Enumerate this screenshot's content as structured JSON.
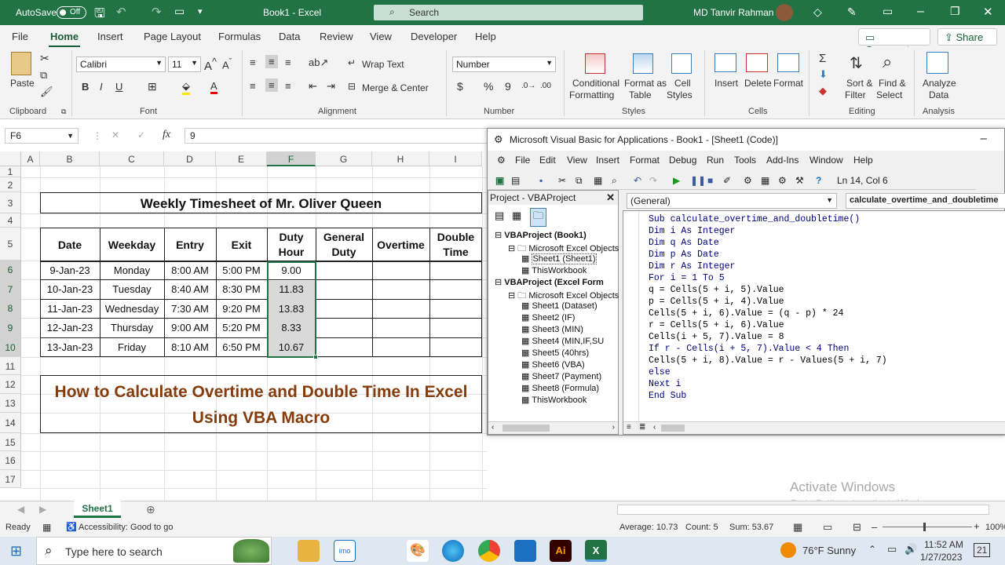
{
  "title_bar": {
    "autosave": "AutoSave",
    "toggle": "Off",
    "doc_title": "Book1  -  Excel",
    "search": "Search",
    "user": "MD Tanvir Rahman"
  },
  "tabs": [
    "File",
    "Home",
    "Insert",
    "Page Layout",
    "Formulas",
    "Data",
    "Review",
    "View",
    "Developer",
    "Help"
  ],
  "comments": "Comments",
  "share": "Share",
  "ribbon": {
    "paste": "Paste",
    "clipboard": "Clipboard",
    "font_name": "Calibri",
    "font_size": "11",
    "font": "Font",
    "wrap_text": "Wrap Text",
    "merge_center": "Merge & Center",
    "alignment": "Alignment",
    "number_format": "Number",
    "number": "Number",
    "conditional": "Conditional",
    "formatting": "Formatting",
    "format_as": "Format as",
    "table": "Table",
    "cell": "Cell",
    "styles_word": "Styles",
    "styles": "Styles",
    "insert": "Insert",
    "delete": "Delete",
    "format": "Format",
    "cells": "Cells",
    "sort_filter": "Sort &",
    "filter": "Filter",
    "find_select": "Find &",
    "select": "Select",
    "editing": "Editing",
    "analyze": "Analyze",
    "data": "Data",
    "analysis": "Analysis"
  },
  "formula_bar": {
    "name_box": "F6",
    "formula": "9"
  },
  "columns": [
    "A",
    "B",
    "C",
    "D",
    "E",
    "F",
    "G",
    "H",
    "I"
  ],
  "rows": [
    "1",
    "2",
    "3",
    "4",
    "5",
    "6",
    "7",
    "8",
    "9",
    "10",
    "11",
    "12",
    "13",
    "14",
    "15",
    "16",
    "17"
  ],
  "sheet": {
    "title": "Weekly Timesheet of Mr. Oliver Queen",
    "headers": [
      "Date",
      "Weekday",
      "Entry",
      "Exit",
      "Duty Hour",
      "General Duty",
      "Overtime",
      "Double Time"
    ],
    "data": [
      [
        "9-Jan-23",
        "Monday",
        "8:00 AM",
        "5:00 PM",
        "9.00"
      ],
      [
        "10-Jan-23",
        "Tuesday",
        "8:40 AM",
        "8:30 PM",
        "11.83"
      ],
      [
        "11-Jan-23",
        "Wednesday",
        "7:30 AM",
        "9:20 PM",
        "13.83"
      ],
      [
        "12-Jan-23",
        "Thursday",
        "9:00 AM",
        "5:20 PM",
        "8.33"
      ],
      [
        "13-Jan-23",
        "Friday",
        "8:10 AM",
        "6:50 PM",
        "10.67"
      ]
    ],
    "banner_1": "How to Calculate Overtime and Double Time In Excel",
    "banner_2": "Using VBA Macro"
  },
  "vba": {
    "title": "Microsoft Visual Basic for Applications - Book1 - [Sheet1 (Code)]",
    "menu": [
      "File",
      "Edit",
      "View",
      "Insert",
      "Format",
      "Debug",
      "Run",
      "Tools",
      "Add-Ins",
      "Window",
      "Help"
    ],
    "position": "Ln 14, Col 6",
    "project_title": "Project - VBAProject",
    "tree": [
      "VBAProject (Book1)",
      "Microsoft Excel Objects",
      "Sheet1 (Sheet1)",
      "ThisWorkbook",
      "VBAProject (Excel Form",
      "Microsoft Excel Objects",
      "Sheet1 (Dataset)",
      "Sheet2 (IF)",
      "Sheet3 (MIN)",
      "Sheet4 (MIN,IF,SU",
      "Sheet5 (40hrs)",
      "Sheet6 (VBA)",
      "Sheet7 (Payment)",
      "Sheet8 (Formula)",
      "ThisWorkbook"
    ],
    "object_dd": "(General)",
    "proc_dd": "calculate_overtime_and_doubletime",
    "code": [
      "Sub calculate_overtime_and_doubletime()",
      "Dim i As Integer",
      "Dim q As Date",
      "Dim p As Date",
      "Dim r As Integer",
      "For i = 1 To 5",
      "q = Cells(5 + i, 5).Value",
      "p = Cells(5 + i, 4).Value",
      "Cells(5 + i, 6).Value = (q - p) * 24",
      "r = Cells(5 + i, 6).Value",
      "Cells(i + 5, 7).Value = 8",
      "If r - Cells(i + 5, 7).Value < 4 Then",
      "Cells(5 + i, 8).Value = r - Values(5 + i, 7)",
      "else",
      "Next i",
      "End Sub"
    ]
  },
  "sheet_tab": "Sheet1",
  "status": {
    "ready": "Ready",
    "accessibility": "Accessibility: Good to go",
    "average": "Average: 10.73",
    "count": "Count: 5",
    "sum": "Sum: 53.67",
    "zoom": "100%"
  },
  "watermark": {
    "line1": "Activate Windows",
    "line2": "Go to Settings to activate Windows."
  },
  "taskbar": {
    "search": "Type here to search",
    "weather": "76°F  Sunny",
    "time": "11:52 AM",
    "date": "1/27/2023",
    "notif": "21"
  }
}
